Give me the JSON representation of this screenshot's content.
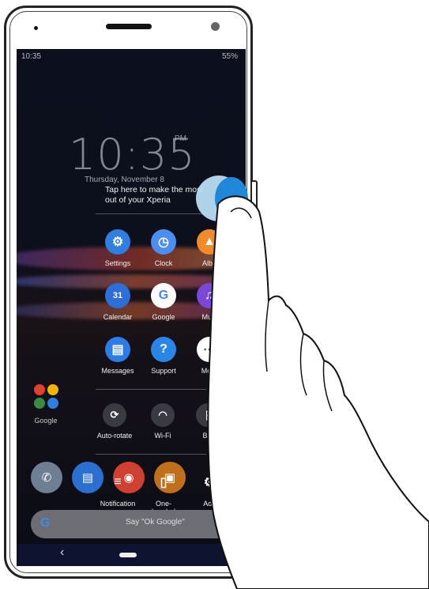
{
  "status": {
    "time": "10:35",
    "battery": "55%"
  },
  "lockscreen": {
    "clock": "10:35",
    "ampm": "PM",
    "date": "Thursday, November 8"
  },
  "tip": {
    "line1": "Tap here to make the most",
    "line2": "out of your Xperia"
  },
  "apps": [
    {
      "label": "Settings",
      "icon": "gear-icon",
      "color": "#2f7fe0"
    },
    {
      "label": "Clock",
      "icon": "clock-icon",
      "color": "#4b8ef1"
    },
    {
      "label": "Albu",
      "icon": "album-icon",
      "color": "#f08b2a"
    },
    {
      "label": "Calendar",
      "icon": "calendar-icon",
      "color": "#2d6fd8"
    },
    {
      "label": "Google",
      "icon": "google-icon",
      "color": "#ffffff"
    },
    {
      "label": "Musi",
      "icon": "music-icon",
      "color": "#7a48d8"
    },
    {
      "label": "Messages",
      "icon": "message-icon",
      "color": "#2b7be8"
    },
    {
      "label": "Support",
      "icon": "help-icon",
      "color": "#2a86e6"
    },
    {
      "label": "More",
      "icon": "more-icon",
      "color": "#ffffff"
    }
  ],
  "calendar_day": "31",
  "quick_settings": [
    {
      "label": "Auto-rotate",
      "icon": "rotate-icon"
    },
    {
      "label": "Wi-Fi",
      "icon": "wifi-icon"
    },
    {
      "label": "Blu",
      "icon": "bluetooth-icon"
    }
  ],
  "bottom_tools": [
    {
      "label": "Notification",
      "icon": "notification-icon"
    },
    {
      "label": "One-handed mode",
      "icon": "one-handed-icon"
    },
    {
      "label": "Adv",
      "icon": "advanced-icon"
    }
  ],
  "home": {
    "folder_label": "Google"
  },
  "search": {
    "placeholder": "Say \"Ok Google\""
  },
  "colors": {
    "accent": "#2f7fe0",
    "screen_bg": "#0b0f1d"
  }
}
